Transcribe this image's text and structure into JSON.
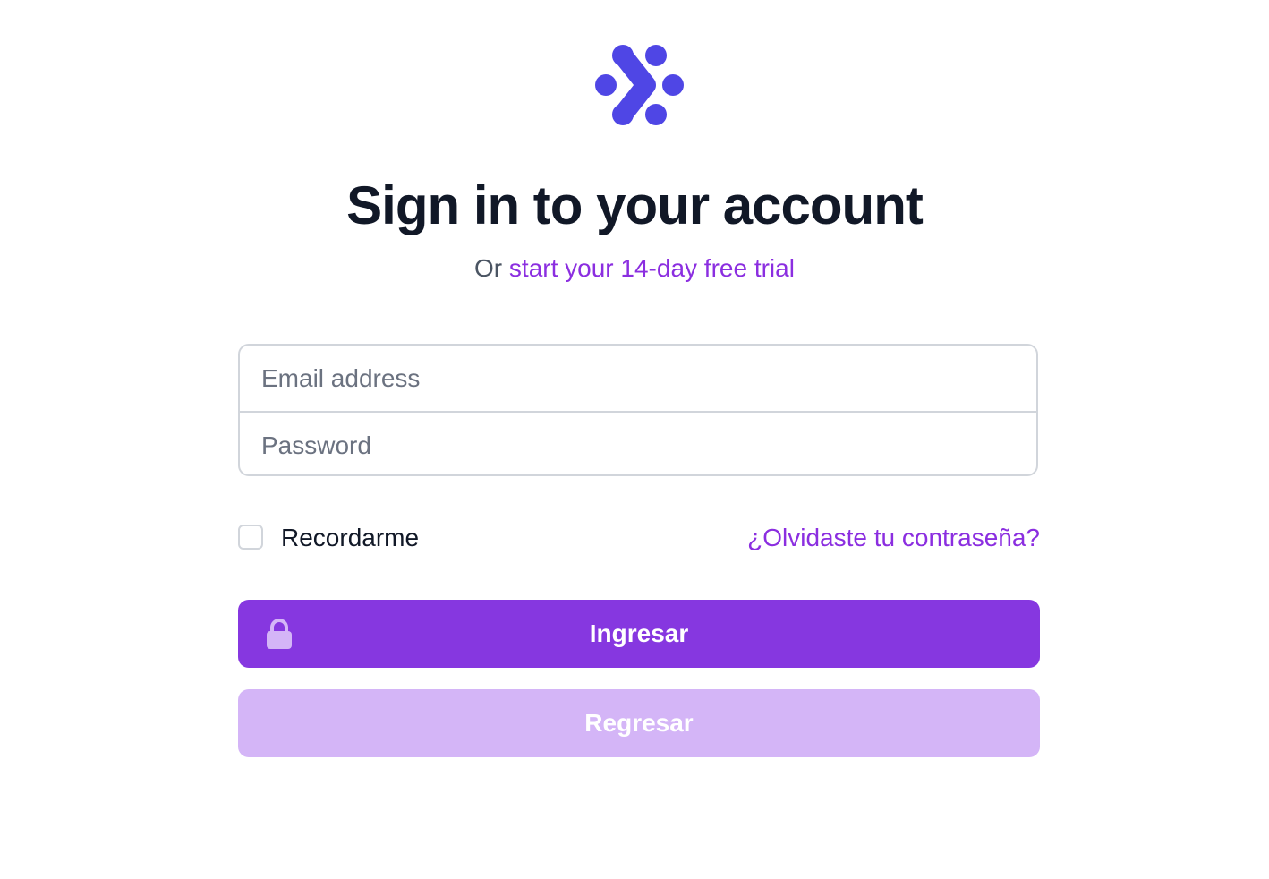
{
  "header": {
    "logo_icon": "network-dots-logo",
    "title": "Sign in to your account",
    "subtitle_prefix": "Or",
    "subtitle_link": "start your 14-day free trial"
  },
  "form": {
    "email": {
      "placeholder": "Email address",
      "value": ""
    },
    "password": {
      "placeholder": "Password",
      "value": ""
    },
    "remember_label": "Recordarme",
    "remember_checked": false,
    "forgot_link": "¿Olvidaste tu contraseña?",
    "submit_label": "Ingresar",
    "submit_icon": "lock-icon",
    "back_label": "Regresar"
  },
  "colors": {
    "logo": "#4f46e5",
    "accent": "#8b2ee0",
    "primary_button": "#8637e0",
    "secondary_button": "#d4b5f7",
    "title": "#111827"
  }
}
